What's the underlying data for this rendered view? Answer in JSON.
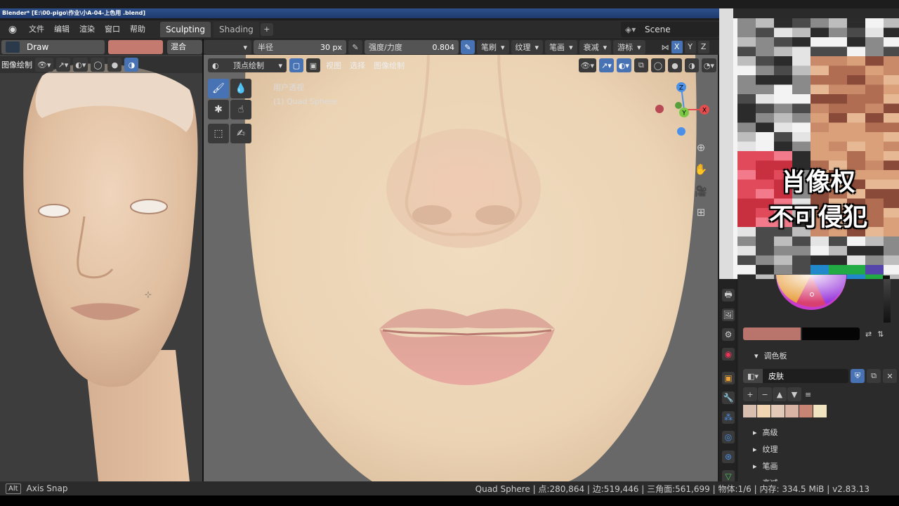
{
  "titlebar": {
    "text": "Blender* [E:\\00-pigo\\作业\\小A-04-上色用 .blend]"
  },
  "menu": {
    "file": "文件",
    "edit": "编辑",
    "render": "渲染",
    "window": "窗口",
    "help": "帮助"
  },
  "workspaces": {
    "sculpting": "Sculpting",
    "shading": "Shading",
    "add": "+"
  },
  "scene": {
    "name": "Scene"
  },
  "left_header": {
    "brush": "Draw",
    "blend": "混合",
    "mode": "图像绘制",
    "color": "#c57a6f"
  },
  "main_header": {
    "radius_label": "半径",
    "radius_value": "30 px",
    "strength_label": "强度/力度",
    "strength_value": "0.804",
    "brush_menu": "笔刷",
    "texture_menu": "纹理",
    "stroke_menu": "笔画",
    "falloff_menu": "衰减",
    "cursor_menu": "游标",
    "axis_x": "X",
    "axis_y": "Y",
    "axis_z": "Z"
  },
  "viewport_header": {
    "mode": "顶点绘制",
    "view": "视图",
    "select": "选择",
    "paint": "图像绘制"
  },
  "viewport_info": {
    "view_name": "用户透视",
    "object": "(1) Quad Sphere"
  },
  "gizmo": {
    "x": "X",
    "y": "Y",
    "z": "Z"
  },
  "overlay_text": {
    "line1": "肖像权",
    "line2": "不可侵犯"
  },
  "palette": {
    "panel_title": "调色板",
    "name": "皮肤",
    "swatches": [
      "#d8bfb0",
      "#f1d5b3",
      "#e3c9b8",
      "#d9b3a3",
      "#c98574",
      "#f1e4c0"
    ],
    "primary": "#b9756c",
    "secondary": "#050505"
  },
  "subpanels": {
    "advanced": "高级",
    "texture": "纹理",
    "stroke": "笔画",
    "falloff": "衰减"
  },
  "status": {
    "key": "Alt",
    "hint": "Axis Snap",
    "stats": "Quad Sphere | 点:280,864 | 边:519,446 | 三角面:561,699 | 物体:1/6 | 内存: 334.5 MiB | v2.83.13"
  }
}
